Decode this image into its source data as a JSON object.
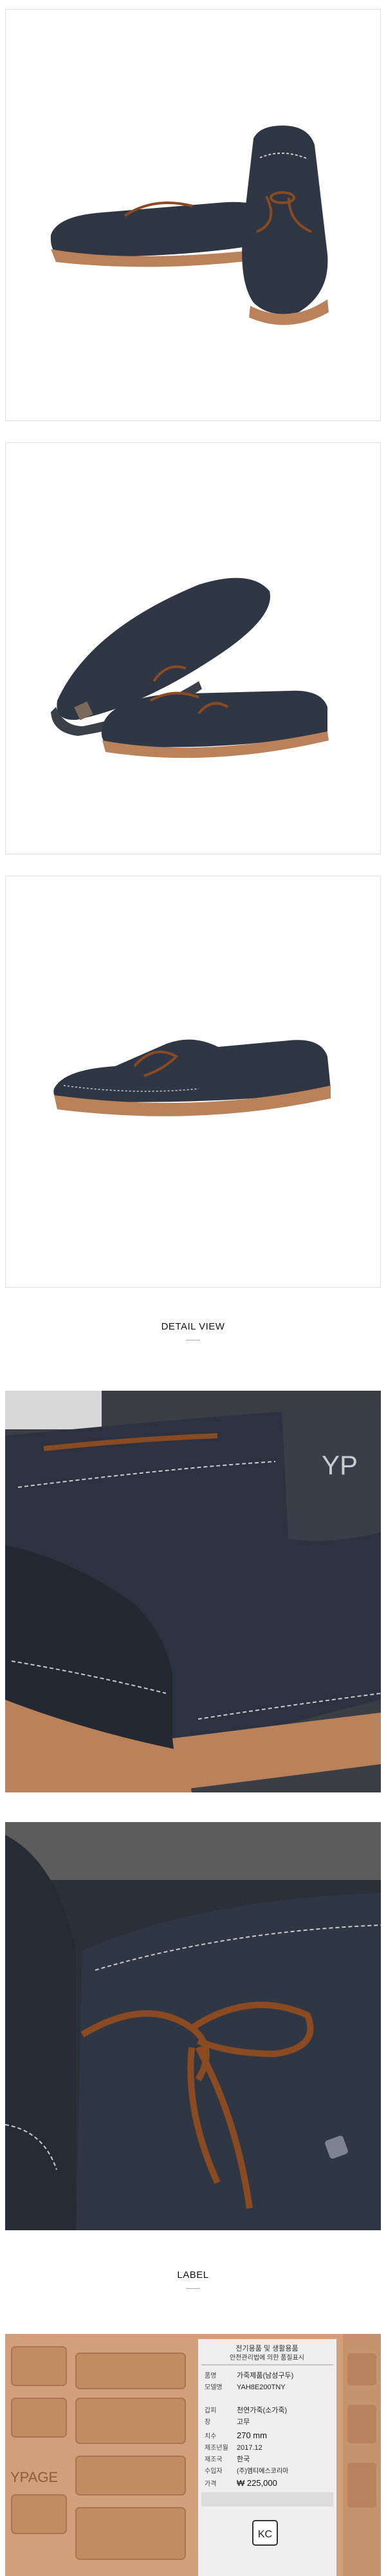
{
  "sections": {
    "detail_title": "DETAIL VIEW",
    "label_title": "LABEL"
  },
  "brand": {
    "emboss_logo": "YP",
    "sole_logo": "YPAGE"
  },
  "label_card": {
    "heading_line1": "전기용품 및 생활용품",
    "heading_line2": "안전관리법에 의한 품질표시",
    "rows": [
      {
        "key": "품명",
        "value": "가죽제품(남성구두)"
      },
      {
        "key": "모델명",
        "value": "YAH8E200TNY"
      },
      {
        "key": "",
        "value": ""
      },
      {
        "key": "갑피",
        "value": "천연가죽(소가죽)"
      },
      {
        "key": "창",
        "value": "고무"
      },
      {
        "key": "치수",
        "value": "270 mm"
      },
      {
        "key": "제조년월",
        "value": "2017.12"
      },
      {
        "key": "제조국",
        "value": "한국"
      },
      {
        "key": "수입자",
        "value": "(주)엠티에스코리아"
      },
      {
        "key": "가격",
        "value": "₩ 225,000"
      }
    ],
    "mark": "KC"
  },
  "colors": {
    "leather": "#2f3644",
    "leather_light": "#4a5263",
    "lace": "#8a4a22",
    "sole": "#b9825a",
    "stitch": "#c8ccd2"
  }
}
